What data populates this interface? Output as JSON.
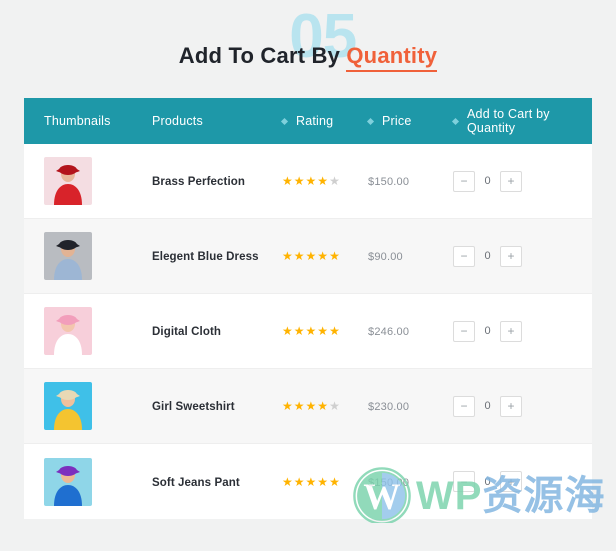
{
  "header": {
    "watermark_number": "05",
    "title_main": "Add To Cart By",
    "title_accent": "Quantity"
  },
  "theme": {
    "header_bg": "#1e98a8",
    "accent": "#f0613a",
    "page_bg": "#f1f2f2",
    "star_on": "#ffb300",
    "star_off": "#cfcfcf",
    "number_watermark": "#b9e4ef"
  },
  "table": {
    "columns": [
      {
        "label": "Thumbnails",
        "sortable": false
      },
      {
        "label": "Products",
        "sortable": false
      },
      {
        "label": "Rating",
        "sortable": true
      },
      {
        "label": "Price",
        "sortable": true
      },
      {
        "label": "Add to Cart by Quantity",
        "sortable": true
      }
    ],
    "rows": [
      {
        "name": "Brass Perfection",
        "rating": 4,
        "rating_max": 5,
        "price": "$150.00",
        "qty": "0",
        "thumb": {
          "bg": "#f4dde2",
          "subject": "#d8232a",
          "accent": "#b3141c",
          "skin": "#e8b79b"
        }
      },
      {
        "name": "Elegent Blue Dress",
        "rating": 5,
        "rating_max": 5,
        "price": "$90.00",
        "qty": "0",
        "thumb": {
          "bg": "#b9bcc1",
          "subject": "#9db6d4",
          "accent": "#21232a",
          "skin": "#e2b394"
        }
      },
      {
        "name": "Digital Cloth",
        "rating": 5,
        "rating_max": 5,
        "price": "$246.00",
        "qty": "0",
        "thumb": {
          "bg": "#f7cfda",
          "subject": "#ffffff",
          "accent": "#f29ebb",
          "skin": "#f3c6ae"
        }
      },
      {
        "name": "Girl Sweetshirt",
        "rating": 4,
        "rating_max": 5,
        "price": "$230.00",
        "qty": "0",
        "thumb": {
          "bg": "#3fc0e8",
          "subject": "#f4c430",
          "accent": "#e8d9b5",
          "skin": "#f0c09c"
        }
      },
      {
        "name": "Soft Jeans Pant",
        "rating": 5,
        "rating_max": 5,
        "price": "$150.00",
        "qty": "0",
        "thumb": {
          "bg": "#8fd6e8",
          "subject": "#1f6fd0",
          "accent": "#7b2fbe",
          "skin": "#edb894"
        }
      }
    ],
    "stepper": {
      "decrement_label": "−",
      "increment_label": "+"
    }
  },
  "watermark": {
    "latin": "WP",
    "cjk": "资源海",
    "logo": "wordpress-logo"
  }
}
